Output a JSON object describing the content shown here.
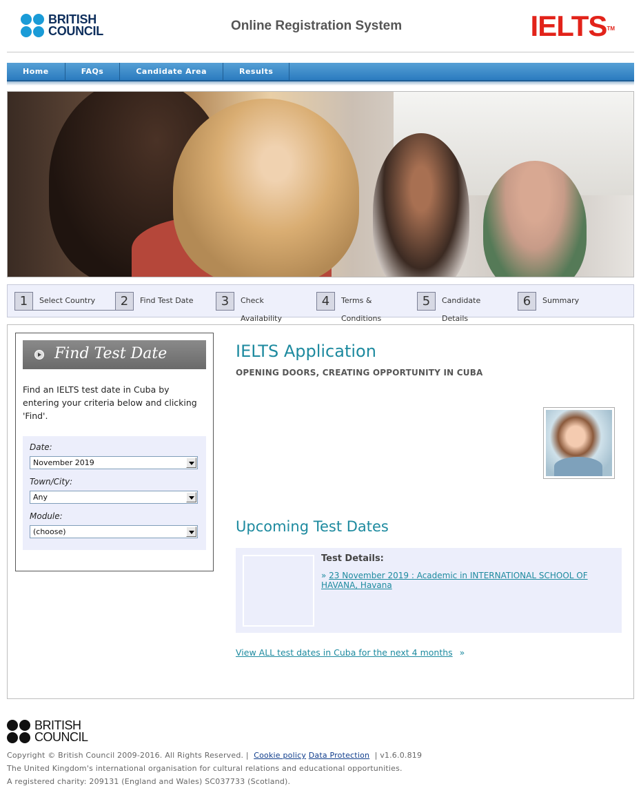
{
  "header": {
    "bc_logo_line1": "BRITISH",
    "bc_logo_line2": "COUNCIL",
    "site_title": "Online Registration System",
    "ielts_logo": "IELTS",
    "ielts_tm": "TM"
  },
  "nav": {
    "items": [
      "Home",
      "FAQs",
      "Candidate Area",
      "Results"
    ]
  },
  "steps": [
    {
      "num": "1",
      "label": "Select Country"
    },
    {
      "num": "2",
      "label": "Find Test Date"
    },
    {
      "num": "3",
      "label": "Check Availability"
    },
    {
      "num": "4",
      "label": "Terms & Conditions"
    },
    {
      "num": "5",
      "label": "Candidate Details"
    },
    {
      "num": "6",
      "label": "Summary"
    }
  ],
  "sidebar": {
    "title": "Find Test Date",
    "description": "Find an IELTS test date in Cuba by entering your criteria below and clicking 'Find'.",
    "date_label": "Date:",
    "date_value": "November 2019",
    "town_label": "Town/City:",
    "town_value": "Any",
    "module_label": "Module:",
    "module_value": "(choose)"
  },
  "content": {
    "title": "IELTS Application",
    "subtitle": "OPENING DOORS, CREATING OPPORTUNITY IN CUBA",
    "upcoming_title": "Upcoming Test Dates",
    "test_details_label": "Test Details:",
    "test_bullet": "»",
    "test_link": "23 November 2019 : Academic in INTERNATIONAL SCHOOL OF HAVANA, Havana",
    "view_all": "View ALL test dates in Cuba for the next 4 months",
    "view_all_arrow": "»"
  },
  "footer": {
    "logo_line1": "BRITISH",
    "logo_line2": "COUNCIL",
    "copyright": "Copyright © British Council 2009-2016. All Rights Reserved. |",
    "cookie_policy": "Cookie policy",
    "data_protection": "Data Protection",
    "version": "| v1.6.0.819",
    "line2": "The United Kingdom's international organisation for cultural relations and educational opportunities.",
    "line3": "A registered charity: 209131 (England and Wales) SC037733 (Scotland)."
  },
  "colors": {
    "accent": "#1d8a9f",
    "nav_blue": "#2b7bbf",
    "ielts_red": "#e2231a"
  }
}
